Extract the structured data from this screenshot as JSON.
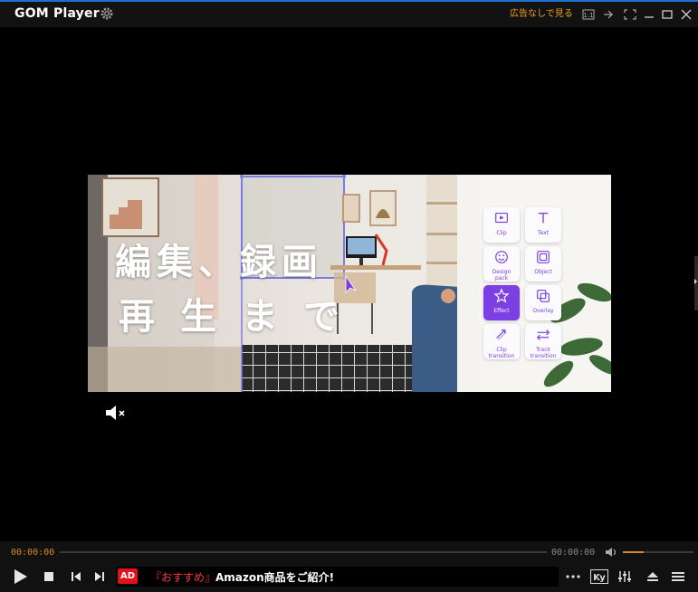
{
  "titlebar": {
    "app_name": "GOM Player",
    "ad_free_label": "広告なしで見る",
    "window_buttons": [
      "compact-mode-icon",
      "always-on-top-icon",
      "fullscreen-icon",
      "minimize-icon",
      "maximize-icon",
      "close-icon"
    ]
  },
  "video": {
    "banner": {
      "headline_line1": "編集、録画",
      "headline_line2": "再生まで",
      "tools": [
        {
          "label": "Clip",
          "icon": "clip-icon"
        },
        {
          "label": "Text",
          "icon": "text-icon"
        },
        {
          "label": "Design pack",
          "icon": "design-pack-icon"
        },
        {
          "label": "Object",
          "icon": "object-icon"
        },
        {
          "label": "Effect",
          "icon": "effect-icon",
          "active": true
        },
        {
          "label": "Overlay",
          "icon": "overlay-icon"
        },
        {
          "label": "Clip transition",
          "icon": "clip-transition-icon"
        },
        {
          "label": "Track transition",
          "icon": "track-transition-icon"
        }
      ],
      "accent_color": "#7b3fe4"
    },
    "muted": true
  },
  "controls": {
    "current_time": "00:00:00",
    "total_time": "00:00:00",
    "volume_level": 0.3,
    "accent_color": "#d98a1c",
    "ad": {
      "badge": "AD",
      "highlight": "『おすすめ』",
      "text": "Amazon商品をご紹介!"
    }
  }
}
